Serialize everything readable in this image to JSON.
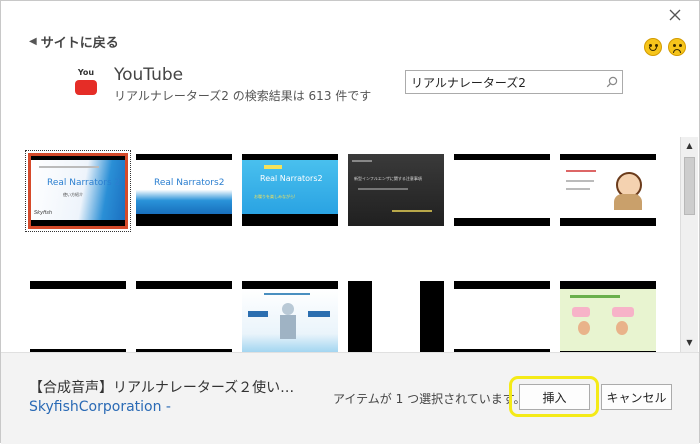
{
  "header": {
    "back_label": "サイトに戻る",
    "close_icon": "close-icon",
    "feedback": {
      "happy_icon": "smiley-happy-icon",
      "sad_icon": "smiley-sad-icon"
    }
  },
  "source": {
    "logo_text": "You",
    "name": "YouTube",
    "result_summary": "リアルナレーターズ2 の検索結果は 613 件です"
  },
  "search": {
    "value": "リアルナレーターズ2",
    "icon": "search-icon"
  },
  "results": {
    "thumbnails": [
      {
        "title": "Real Narrators 2",
        "subtitle": "使い方紹介",
        "caption": "Skyfish",
        "selected": true
      },
      {
        "title": "Real Narrators2",
        "subtitle": "",
        "caption": "",
        "selected": false
      },
      {
        "title": "Real Narrators2",
        "subtitle": "お喋りを楽しみながら!",
        "caption": "",
        "selected": false
      },
      {
        "title": "新型インフルエンザに関する注意事項",
        "subtitle": "",
        "caption": "",
        "selected": false
      },
      {
        "title": "",
        "subtitle": "",
        "caption": "",
        "selected": false
      },
      {
        "title": "",
        "subtitle": "",
        "caption": "",
        "selected": false
      },
      {
        "title": "",
        "subtitle": "",
        "caption": "",
        "selected": false
      },
      {
        "title": "",
        "subtitle": "",
        "caption": "",
        "selected": false
      },
      {
        "title": "",
        "subtitle": "",
        "caption": "",
        "selected": false
      },
      {
        "title": "",
        "subtitle": "",
        "caption": "",
        "selected": false
      },
      {
        "title": "",
        "subtitle": "",
        "caption": "",
        "selected": false
      },
      {
        "title": "",
        "subtitle": "",
        "caption": "",
        "selected": false
      }
    ]
  },
  "footer": {
    "video_title": "【合成音声】リアルナレーターズ２使い…",
    "channel": "SkyfishCorporation -",
    "status": "アイテムが 1 つ選択されています。",
    "insert_label": "挿入",
    "cancel_label": "キャンセル"
  },
  "colors": {
    "accent": "#d64a2a",
    "link": "#2a6ab5",
    "highlight": "#f4ea17",
    "youtube_red": "#e52d27"
  }
}
